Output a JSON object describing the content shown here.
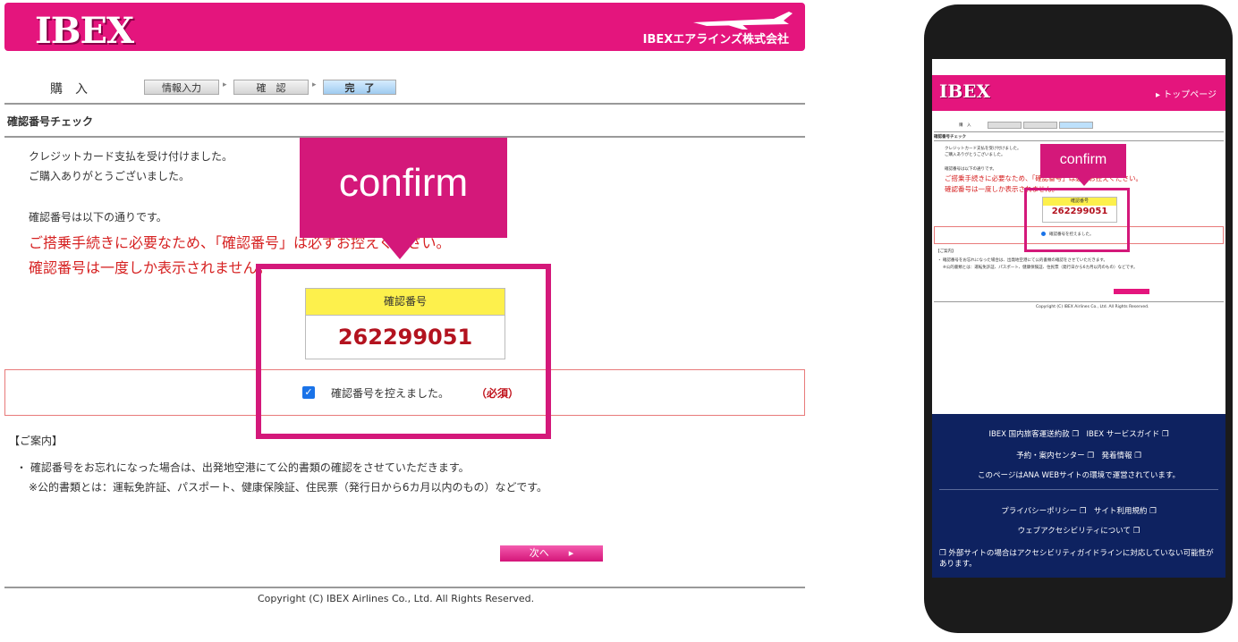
{
  "desktop": {
    "logo": "IBEX",
    "company": "IBEXエアラインズ株式会社",
    "steps": {
      "label": "購　入",
      "items": [
        "情報入力",
        "確　認",
        "完　了"
      ]
    },
    "section_title": "確認番号チェック",
    "messages": [
      "クレジットカード支払を受け付けました。",
      "ご購入ありがとうございました。"
    ],
    "intro": "確認番号は以下の通りです。",
    "warning1": "ご搭乗手続きに必要なため、「確認番号」は必ずお控えください。",
    "warning2": "確認番号は一度しか表示されません。",
    "confirm_label": "確認番号",
    "confirm_number": "262299051",
    "checkbox_label": "確認番号を控えました。",
    "required": "（必須）",
    "guide_title": "【ご案内】",
    "guide1": "・ 確認番号をお忘れになった場合は、出発地空港にて公的書類の確認をさせていただきます。",
    "guide2": "※公的書類とは：運転免許証、パスポート、健康保険証、住民票（発行日から6カ月以内のもの）などです。",
    "next": "次へ",
    "copyright": "Copyright (C) IBEX Airlines Co., Ltd. All Rights Reserved."
  },
  "callout": "confirm",
  "mobile": {
    "logo": "IBEX",
    "top_link": "▸ トップページ",
    "callout": "confirm",
    "confirm_label": "確認番号",
    "confirm_number": "262299051",
    "footer": [
      "IBEX 国内旅客運送約款 ❐　IBEX サービスガイド ❐",
      "予約・案内センター ❐　発着情報 ❐",
      "このページはANA WEBサイトの環境で運営されています。",
      "プライバシーポリシー ❐　サイト利用規約 ❐",
      "ウェブアクセシビリティについて ❐",
      "❐ 外部サイトの場合はアクセシビリティガイドラインに対応していない可能性があります。"
    ]
  }
}
